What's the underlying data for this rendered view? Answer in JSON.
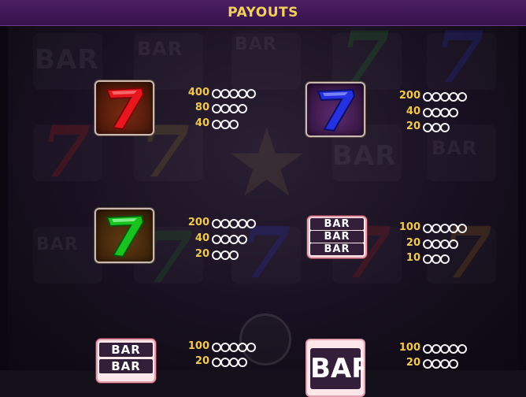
{
  "header": {
    "title": "PAYOUTS"
  },
  "background_ghost": {
    "bar_label": "BAR"
  },
  "colors": {
    "title": "#f4cf5c",
    "amount": "#f2c94c",
    "seven_red": "#e8161e",
    "seven_blue": "#2530e0",
    "seven_green": "#19c21f"
  },
  "entries": [
    {
      "symbol": "red-seven",
      "icon": "red-seven-icon",
      "payouts": [
        {
          "amount": "400",
          "count": 5
        },
        {
          "amount": "80",
          "count": 4
        },
        {
          "amount": "40",
          "count": 3
        }
      ]
    },
    {
      "symbol": "blue-seven",
      "icon": "blue-seven-icon",
      "payouts": [
        {
          "amount": "200",
          "count": 5
        },
        {
          "amount": "40",
          "count": 4
        },
        {
          "amount": "20",
          "count": 3
        }
      ]
    },
    {
      "symbol": "green-seven",
      "icon": "green-seven-icon",
      "payouts": [
        {
          "amount": "200",
          "count": 5
        },
        {
          "amount": "40",
          "count": 4
        },
        {
          "amount": "20",
          "count": 3
        }
      ]
    },
    {
      "symbol": "triple-bar",
      "icon": "triple-bar-icon",
      "label": "BAR",
      "payouts": [
        {
          "amount": "100",
          "count": 5
        },
        {
          "amount": "20",
          "count": 4
        },
        {
          "amount": "10",
          "count": 3
        }
      ]
    },
    {
      "symbol": "double-bar",
      "icon": "double-bar-icon",
      "label": "BAR",
      "payouts": [
        {
          "amount": "100",
          "count": 5
        },
        {
          "amount": "20",
          "count": 4
        }
      ]
    },
    {
      "symbol": "single-bar",
      "icon": "single-bar-icon",
      "label": "BAR",
      "payouts": [
        {
          "amount": "100",
          "count": 5
        },
        {
          "amount": "20",
          "count": 4
        }
      ]
    }
  ]
}
